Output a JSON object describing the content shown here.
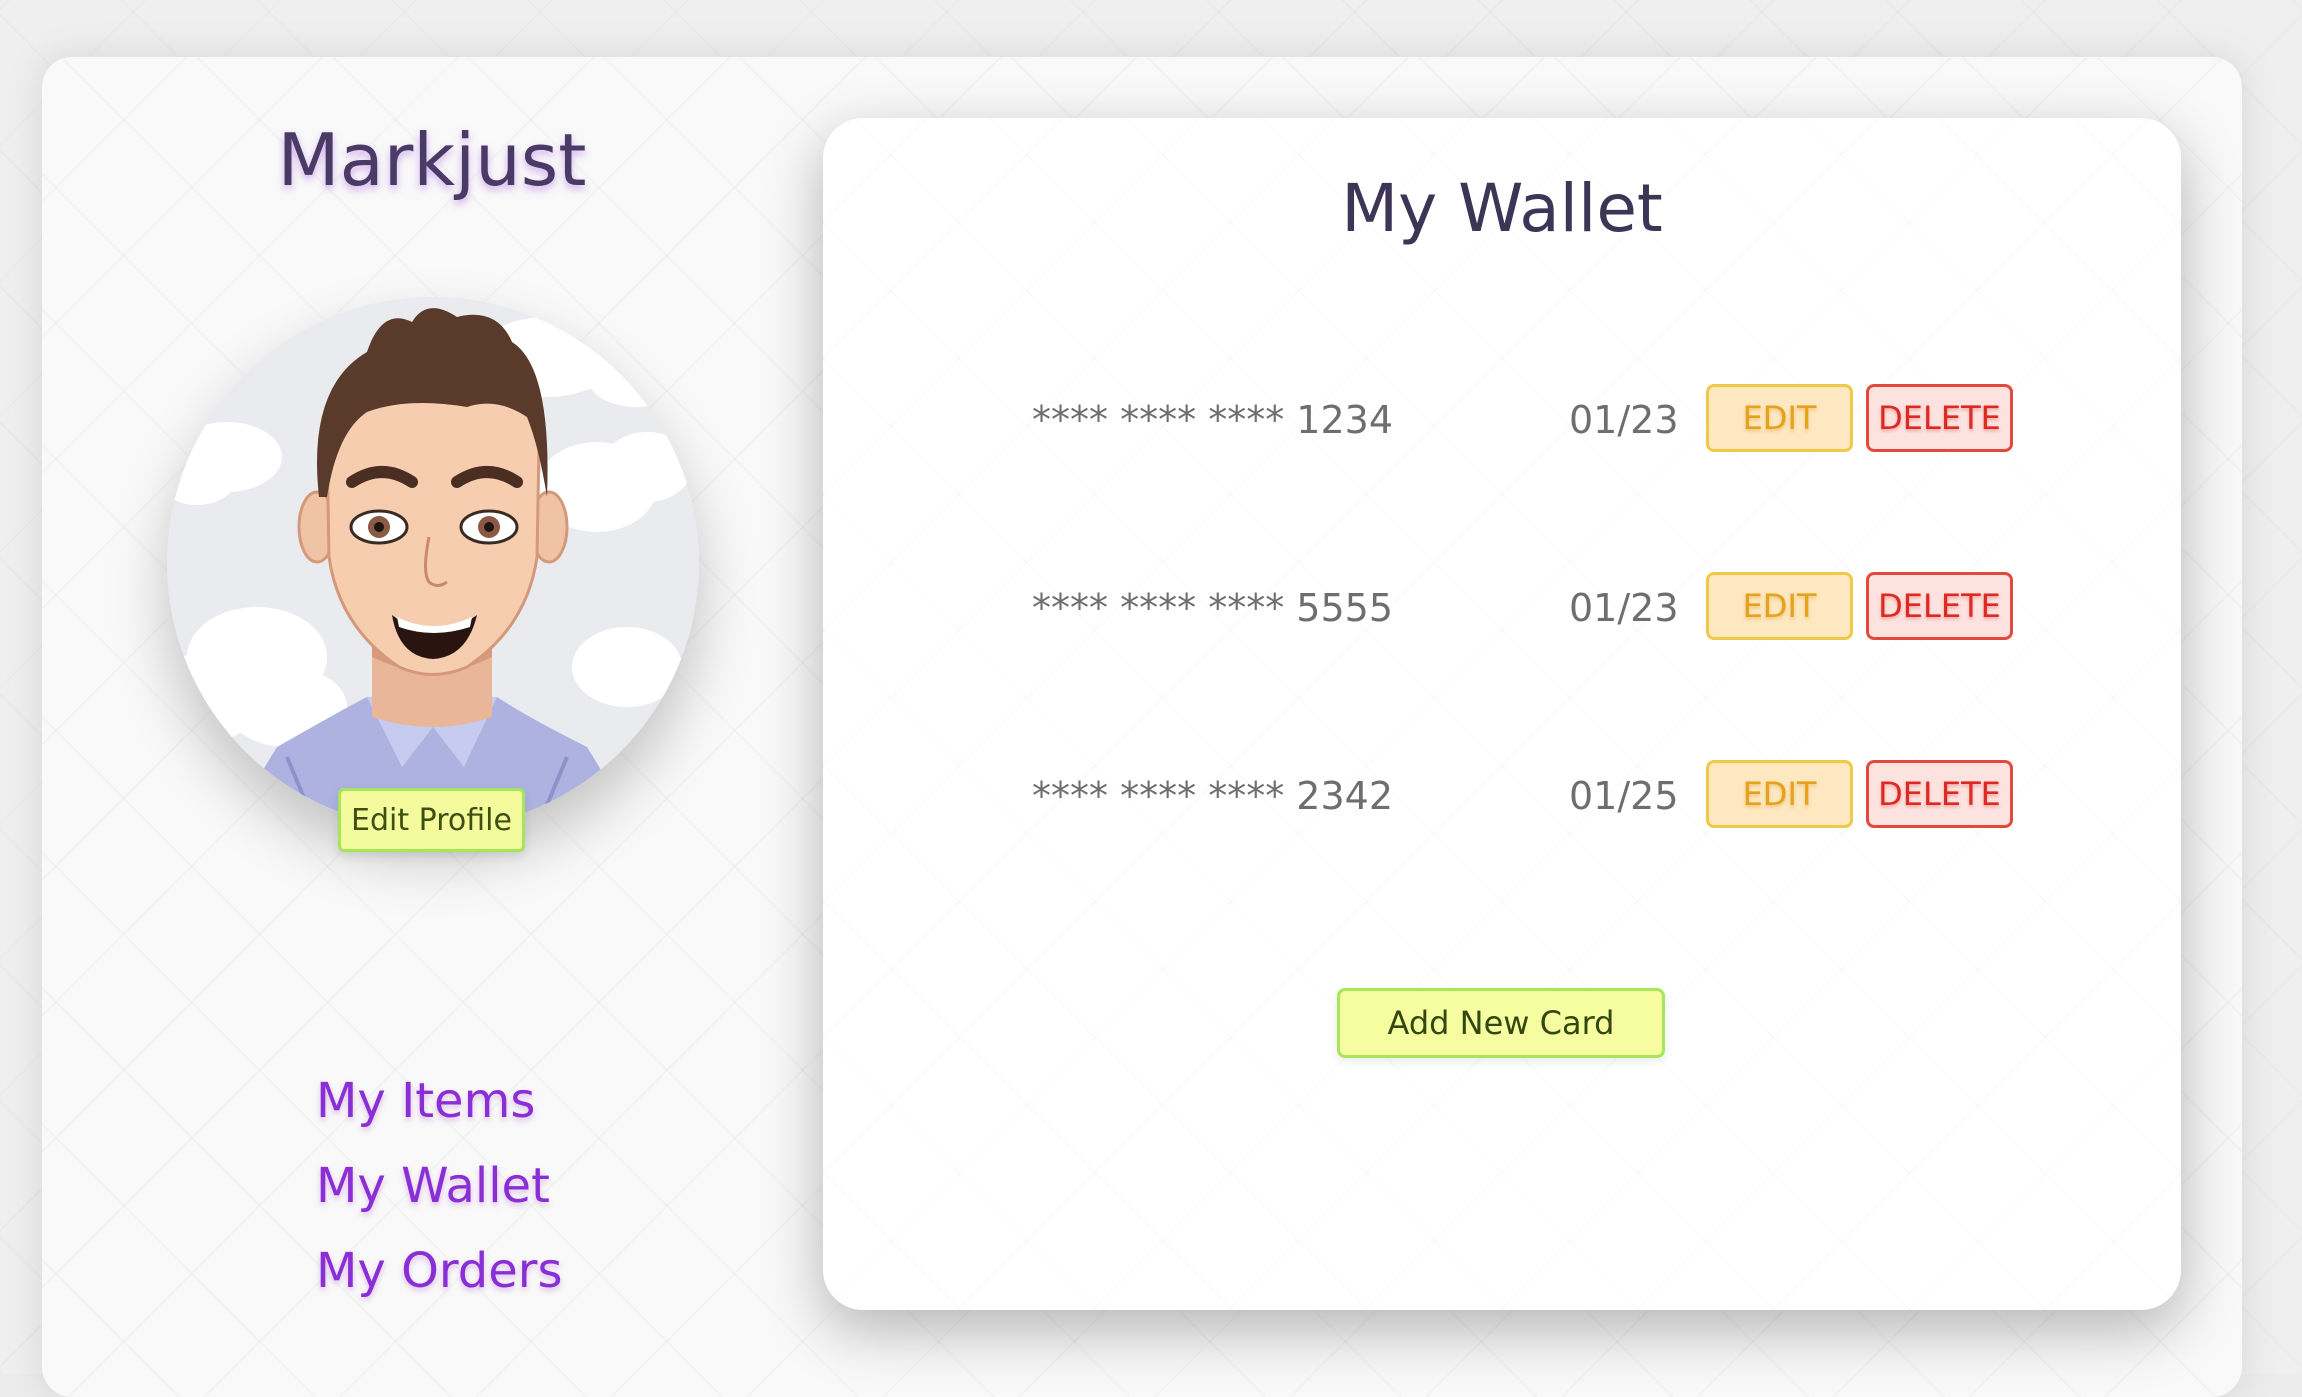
{
  "profile": {
    "username": "Markjust",
    "edit_profile_label": "Edit Profile"
  },
  "nav": {
    "items": [
      {
        "label": "My Items"
      },
      {
        "label": "My Wallet"
      },
      {
        "label": "My Orders"
      }
    ]
  },
  "wallet": {
    "title": "My Wallet",
    "cards": [
      {
        "number": "**** **** **** 1234",
        "expiry": "01/23",
        "edit_label": "EDIT",
        "delete_label": "DELETE"
      },
      {
        "number": "**** **** **** 5555",
        "expiry": "01/23",
        "edit_label": "EDIT",
        "delete_label": "DELETE"
      },
      {
        "number": "**** **** **** 2342",
        "expiry": "01/25",
        "edit_label": "EDIT",
        "delete_label": "DELETE"
      }
    ],
    "add_card_label": "Add New Card"
  },
  "colors": {
    "accent_purple": "#8a2fd6",
    "edit_yellow": "#f2c847",
    "delete_red": "#e44a3c",
    "action_green": "#a7e55a"
  }
}
